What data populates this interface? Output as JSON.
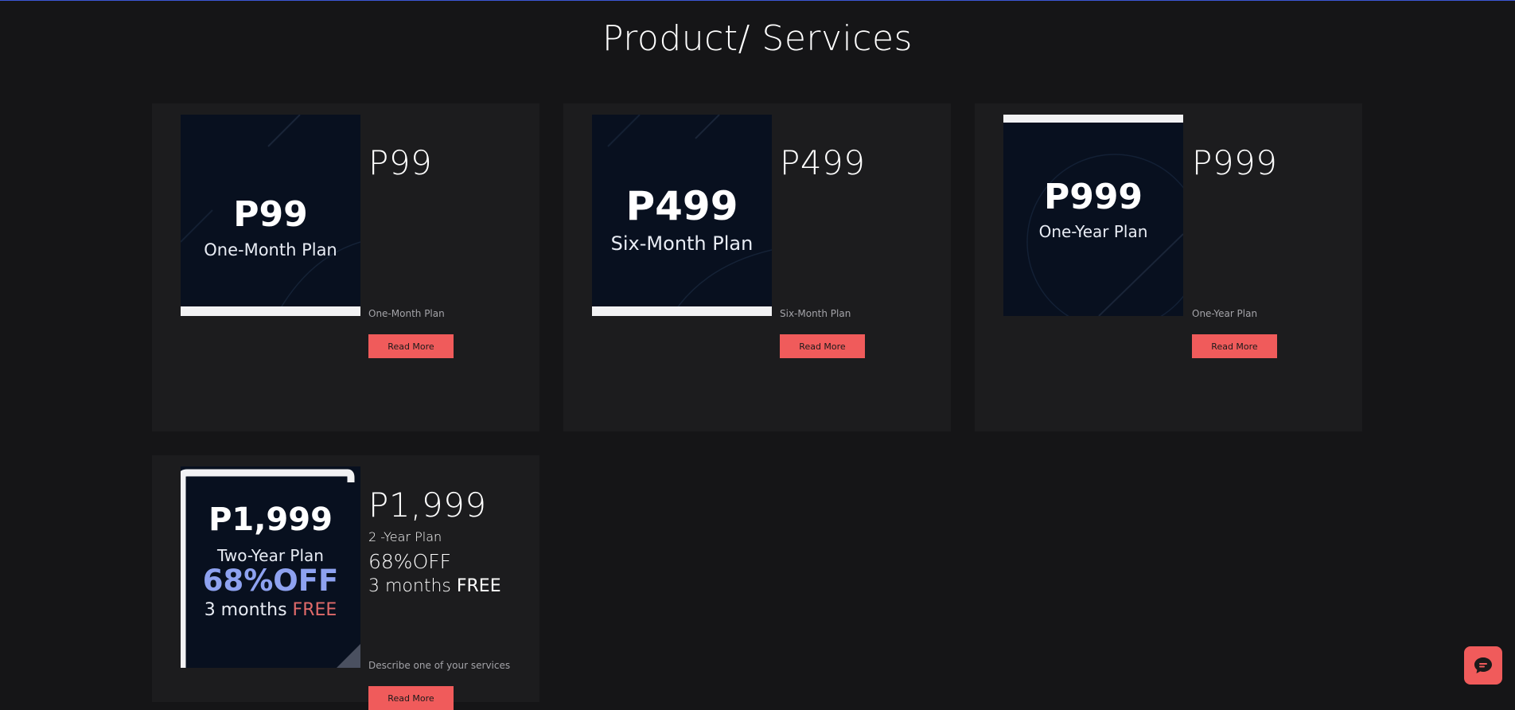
{
  "page": {
    "title": "Product/ Services"
  },
  "colors": {
    "accent": "#f05b5b",
    "background": "#151517",
    "card": "#1c1c1e",
    "thumb": "#08101f"
  },
  "cards": [
    {
      "thumb_price": "P99",
      "thumb_plan": "One-Month Plan",
      "price": "P99",
      "description": "One-Month Plan",
      "button": "Read More"
    },
    {
      "thumb_price": "P499",
      "thumb_plan": "Six-Month Plan",
      "price": "P499",
      "description": "Six-Month Plan",
      "button": "Read More"
    },
    {
      "thumb_price": "P999",
      "thumb_plan": "One-Year Plan",
      "price": "P999",
      "description": "One-Year Plan",
      "button": "Read More"
    },
    {
      "thumb_price": "P1,999",
      "thumb_plan": "Two-Year Plan",
      "thumb_discount": "68%OFF",
      "thumb_free_prefix": "3 months",
      "thumb_free": "FREE",
      "price": "P1,999",
      "subtitle": "2 -Year Plan",
      "discount": "68%OFF",
      "free_prefix": "3 months",
      "free": "FREE",
      "description": "Describe one of your services",
      "button": "Read More"
    }
  ],
  "chat": {
    "icon": "chat-bubble-icon"
  }
}
